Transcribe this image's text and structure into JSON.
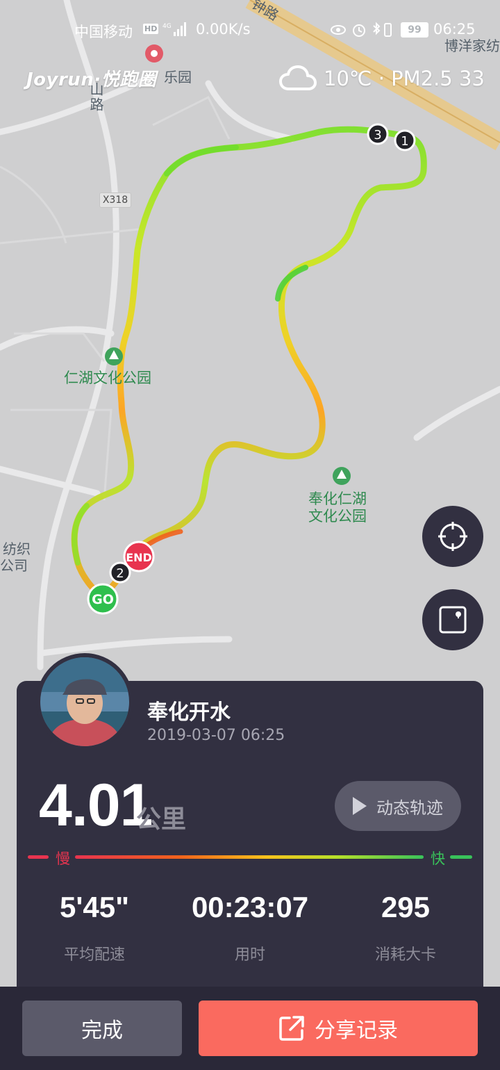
{
  "status_bar": {
    "carrier": "中国移动",
    "hd_badge": "HD",
    "net_speed": "0.00K/s",
    "battery": "99",
    "time": "06:25",
    "icons": [
      "signal-icon",
      "eye-icon",
      "alarm-icon",
      "bluetooth-icon",
      "vibrate-icon",
      "battery-icon"
    ]
  },
  "brand": "Joyrun·悦跑圈",
  "weather": {
    "icon": "cloud-icon",
    "text": "10℃ · PM2.5 33"
  },
  "map": {
    "labels": {
      "top_road": "钟路",
      "top_right": "博洋家纺",
      "amusement": "乐园",
      "left_road": "山路",
      "road_code": "X318",
      "park1": "仁湖文化公园",
      "park2_line1": "奉化仁湖",
      "park2_line2": "文化公园",
      "textile_line1": "纺织",
      "textile_line2": "公司"
    },
    "markers": {
      "start": "GO",
      "end": "END",
      "km1": "1",
      "km2": "2",
      "km3": "3"
    },
    "buttons": [
      "locate-icon",
      "fullscreen-icon"
    ]
  },
  "run": {
    "username": "奉化开水",
    "datetime": "2019-03-07 06:25",
    "distance": "4.01",
    "distance_unit": "公里",
    "track_button": "动态轨迹",
    "legend_slow": "慢",
    "legend_fast": "快",
    "stats": [
      {
        "value": "5'45\"",
        "label": "平均配速"
      },
      {
        "value": "00:23:07",
        "label": "用时"
      },
      {
        "value": "295",
        "label": "消耗大卡"
      }
    ]
  },
  "actions": {
    "done": "完成",
    "share": "分享记录"
  },
  "colors": {
    "panel": "#323041",
    "share_button": "#fa6a5f",
    "slow": "#e8344f",
    "fast": "#39c25a",
    "start_marker": "#2fbf4d",
    "end_marker": "#e8344f"
  }
}
